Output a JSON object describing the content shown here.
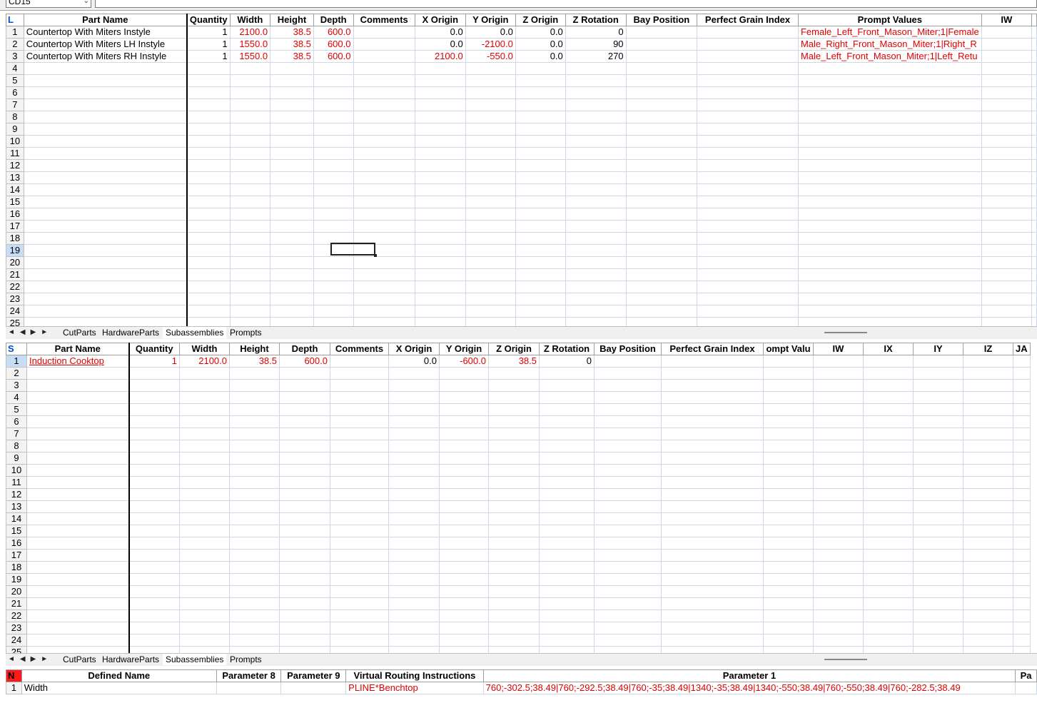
{
  "toolbar": {
    "namebox": "CD15",
    "formula": ""
  },
  "sheet_top": {
    "corner": "L",
    "columns": [
      "Part Name",
      "Quantity",
      "Width",
      "Height",
      "Depth",
      "Comments",
      "X Origin",
      "Y Origin",
      "Z Origin",
      "Z Rotation",
      "Bay Position",
      "Perfect Grain Index",
      "Prompt Values",
      "IW"
    ],
    "rows": [
      {
        "n": "1",
        "part": "Countertop With Miters Instyle",
        "qty": "1",
        "w": "2100.0",
        "h": "38.5",
        "d": "600.0",
        "c": "",
        "x": "0.0",
        "y": "0.0",
        "z": "0.0",
        "zr": "0",
        "bay": "",
        "pgi": "",
        "pv": "Female_Left_Front_Mason_Miter;1|Female",
        "iw": ""
      },
      {
        "n": "2",
        "part": "Countertop With Miters LH Instyle",
        "qty": "1",
        "w": "1550.0",
        "h": "38.5",
        "d": "600.0",
        "c": "",
        "x": "0.0",
        "y": "-2100.0",
        "z": "0.0",
        "zr": "90",
        "bay": "",
        "pgi": "",
        "pv": "Male_Right_Front_Mason_Miter;1|Right_R",
        "iw": ""
      },
      {
        "n": "3",
        "part": "Countertop With Miters RH Instyle",
        "qty": "1",
        "w": "1550.0",
        "h": "38.5",
        "d": "600.0",
        "c": "",
        "x": "2100.0",
        "y": "-550.0",
        "z": "0.0",
        "zr": "270",
        "bay": "",
        "pgi": "",
        "pv": "Male_Left_Front_Mason_Miter;1|Left_Retu",
        "iw": ""
      }
    ],
    "row_numbers": [
      "4",
      "5",
      "6",
      "7",
      "8",
      "9",
      "10",
      "11",
      "12",
      "13",
      "14",
      "15",
      "16",
      "17",
      "18",
      "19",
      "20",
      "21",
      "22",
      "23",
      "24",
      "25"
    ],
    "selected_row": "19"
  },
  "sheet_mid": {
    "corner": "S",
    "columns": [
      "Part Name",
      "Quantity",
      "Width",
      "Height",
      "Depth",
      "Comments",
      "X Origin",
      "Y Origin",
      "Z Origin",
      "Z Rotation",
      "Bay Position",
      "Perfect Grain Index",
      "ompt Valu",
      "IW",
      "IX",
      "IY",
      "IZ",
      "JA"
    ],
    "rows": [
      {
        "n": "1",
        "part": "Induction Cooktop",
        "qty": "1",
        "w": "2100.0",
        "h": "38.5",
        "d": "600.0",
        "c": "",
        "x": "0.0",
        "y": "-600.0",
        "z": "38.5",
        "zr": "0"
      }
    ],
    "row_numbers": [
      "2",
      "3",
      "4",
      "5",
      "6",
      "7",
      "8",
      "9",
      "10",
      "11",
      "12",
      "13",
      "14",
      "15",
      "16",
      "17",
      "18",
      "19",
      "20",
      "21",
      "22",
      "23",
      "24",
      "25"
    ]
  },
  "tabs": [
    "CutParts",
    "HardwareParts",
    "Subassemblies",
    "Prompts"
  ],
  "active_tab": "Subassemblies",
  "sheet_bottom": {
    "corner": "N",
    "columns": [
      "Defined Name",
      "Parameter 8",
      "Parameter 9",
      "Virtual Routing Instructions",
      "Parameter 1",
      "Pa"
    ],
    "rows": [
      {
        "n": "1",
        "name": "Width",
        "p8": "",
        "p9": "",
        "vri": "PLINE*Benchtop",
        "p1": "760;-302.5;38.49|760;-292.5;38.49|760;-35;38.49|1340;-35;38.49|1340;-550;38.49|760;-550;38.49|760;-282.5;38.49"
      }
    ]
  },
  "colors": {
    "red": "#e00000",
    "blue": "#0050c8"
  }
}
